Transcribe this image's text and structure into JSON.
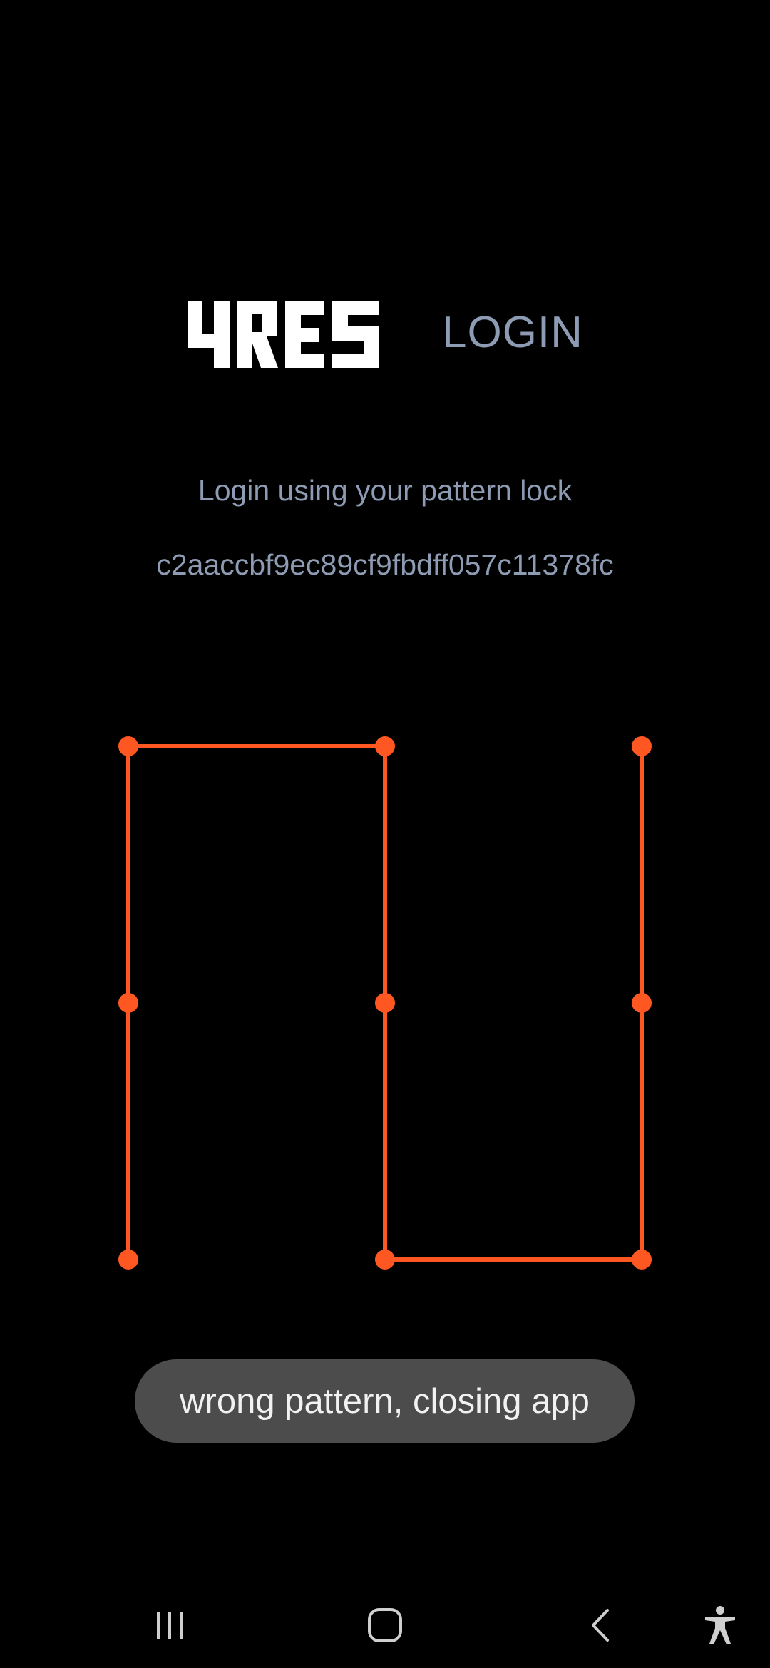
{
  "app": {
    "logo_text": "4RES",
    "title": "LOGIN"
  },
  "content": {
    "subtitle": "Login using your pattern lock",
    "hash": "c2aaccbf9ec89cf9fbdff057c11378fc"
  },
  "pattern": {
    "color": "#ff5722",
    "grid": "3x3",
    "sequence": [
      7,
      4,
      1,
      2,
      5,
      8,
      9,
      6,
      3
    ]
  },
  "toast": {
    "message": "wrong pattern, closing app"
  },
  "navbar": {
    "icons": [
      "recents-icon",
      "home-icon",
      "back-icon",
      "accessibility-icon"
    ]
  }
}
